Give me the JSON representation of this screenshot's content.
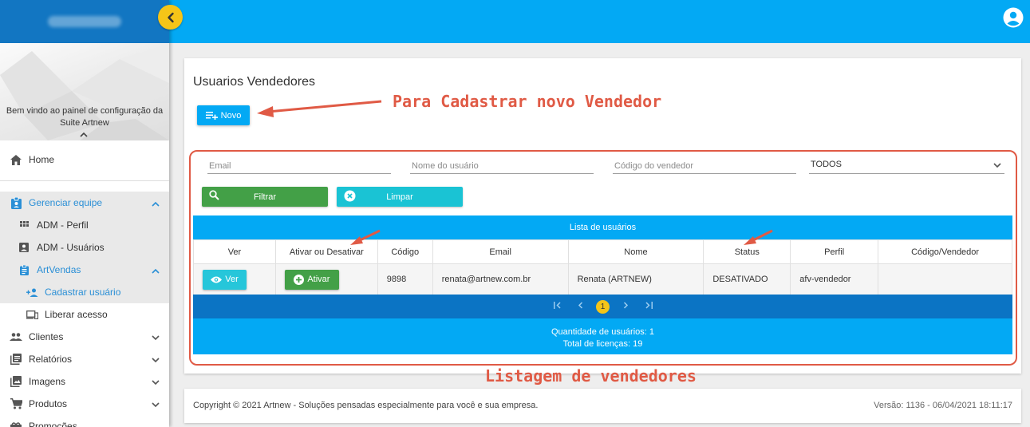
{
  "sidebar": {
    "welcome_line1": "Bem vindo ao painel de configuração da",
    "welcome_line2": "Suite Artnew",
    "items": [
      {
        "label": "Home",
        "icon": "home-icon"
      },
      {
        "label": "Gerenciar equipe",
        "icon": "badge-icon"
      },
      {
        "label": "ADM - Perfil",
        "icon": "grid-icon"
      },
      {
        "label": "ADM - Usuários",
        "icon": "account-box-icon"
      },
      {
        "label": "ArtVendas",
        "icon": "assignment-icon"
      },
      {
        "label": "Cadastrar usuário",
        "icon": "person-add-icon"
      },
      {
        "label": "Liberar acesso",
        "icon": "devices-icon"
      },
      {
        "label": "Clientes",
        "icon": "people-icon"
      },
      {
        "label": "Relatórios",
        "icon": "library-books-icon"
      },
      {
        "label": "Imagens",
        "icon": "photo-library-icon"
      },
      {
        "label": "Produtos",
        "icon": "cart-icon"
      },
      {
        "label": "Promoções",
        "icon": "promo-icon"
      }
    ]
  },
  "page": {
    "title": "Usuarios Vendedores",
    "novo_label": "Novo"
  },
  "filters": {
    "email_placeholder": "Email",
    "nome_placeholder": "Nome do usuário",
    "codigo_placeholder": "Código do vendedor",
    "status_selected": "TODOS",
    "filtrar_label": "Filtrar",
    "limpar_label": "Limpar"
  },
  "list": {
    "header": "Lista de usuários",
    "columns": [
      "Ver",
      "Ativar ou Desativar",
      "Código",
      "Email",
      "Nome",
      "Status",
      "Perfil",
      "Código/Vendedor"
    ],
    "rows": [
      {
        "ver_label": "Ver",
        "ativar_label": "Ativar",
        "codigo": "9898",
        "email": "renata@artnew.com.br",
        "nome": "Renata (ARTNEW)",
        "status": "DESATIVADO",
        "perfil": "afv-vendedor",
        "codigo_vendedor": ""
      }
    ],
    "current_page": "1",
    "quantidade": "Quantidade de usuários: 1",
    "licencas": "Total de licenças: 19"
  },
  "annotations": {
    "novo": "Para Cadastrar novo Vendedor",
    "listagem": "Listagem de vendedores"
  },
  "footer": {
    "copyright": "Copyright © 2021 Artnew - Soluções pensadas especialmente para você e sua empresa.",
    "version": "Versão: 1136 - 06/04/2021 18:11:17"
  },
  "colors": {
    "primary": "#03a9f4",
    "dark_blue": "#0b74c4",
    "accent_yellow": "#f5c518",
    "green": "#43a047",
    "cyan": "#26c6da",
    "annotation_red": "#e05a45"
  }
}
